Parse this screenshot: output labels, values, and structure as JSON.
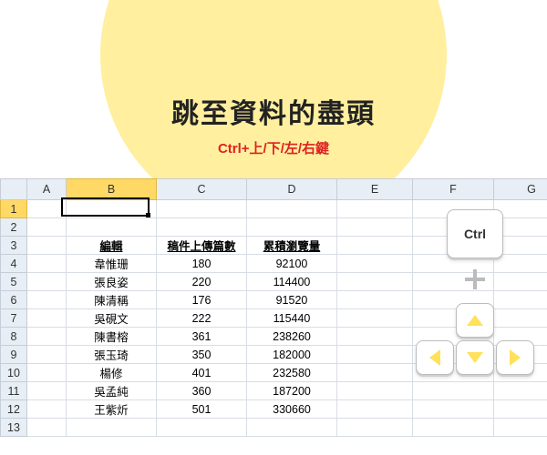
{
  "title": {
    "main": "跳至資料的盡頭",
    "sub": "Ctrl+上/下/左/右鍵"
  },
  "columns": [
    "A",
    "B",
    "C",
    "D",
    "E",
    "F",
    "G"
  ],
  "active_col": "B",
  "active_row": 1,
  "headers": {
    "b": "編輯",
    "c": "稿件上傳篇數",
    "d": "累積瀏覽量"
  },
  "rows": [
    {
      "b": "韋惟珊",
      "c": "180",
      "d": "92100"
    },
    {
      "b": "張良姿",
      "c": "220",
      "d": "114400"
    },
    {
      "b": "陳清稱",
      "c": "176",
      "d": "91520"
    },
    {
      "b": "吳硯文",
      "c": "222",
      "d": "115440"
    },
    {
      "b": "陳書榕",
      "c": "361",
      "d": "238260"
    },
    {
      "b": "張玉琦",
      "c": "350",
      "d": "182000"
    },
    {
      "b": "楊修",
      "c": "401",
      "d": "232580"
    },
    {
      "b": "吳孟純",
      "c": "360",
      "d": "187200"
    },
    {
      "b": "王紫炘",
      "c": "501",
      "d": "330660"
    }
  ],
  "ctrl_label": "Ctrl",
  "chart_data": {
    "type": "table",
    "columns": [
      "編輯",
      "稿件上傳篇數",
      "累積瀏覽量"
    ],
    "data": [
      [
        "韋惟珊",
        180,
        92100
      ],
      [
        "張良姿",
        220,
        114400
      ],
      [
        "陳清稱",
        176,
        91520
      ],
      [
        "吳硯文",
        222,
        115440
      ],
      [
        "陳書榕",
        361,
        238260
      ],
      [
        "張玉琦",
        350,
        182000
      ],
      [
        "楊修",
        401,
        232580
      ],
      [
        "吳孟純",
        360,
        187200
      ],
      [
        "王紫炘",
        501,
        330660
      ]
    ]
  }
}
